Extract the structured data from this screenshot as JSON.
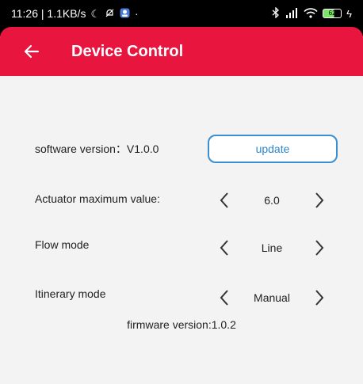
{
  "status_bar": {
    "time_speed": "11:26 | 1.1KB/s",
    "battery_level": "62"
  },
  "header": {
    "title": "Device Control"
  },
  "software": {
    "label": "software version：V1.0.0",
    "update_label": "update"
  },
  "actuator": {
    "label": "Actuator maximum value:",
    "value": "6.0"
  },
  "flow": {
    "label": "Flow mode",
    "value": "Line"
  },
  "itinerary": {
    "label": "Itinerary mode",
    "value": "Manual"
  },
  "firmware": {
    "label": "firmware version:1.0.2"
  },
  "colors": {
    "header": "#e8153f",
    "accent": "#3a8fd1",
    "background": "#f3f3f3"
  }
}
